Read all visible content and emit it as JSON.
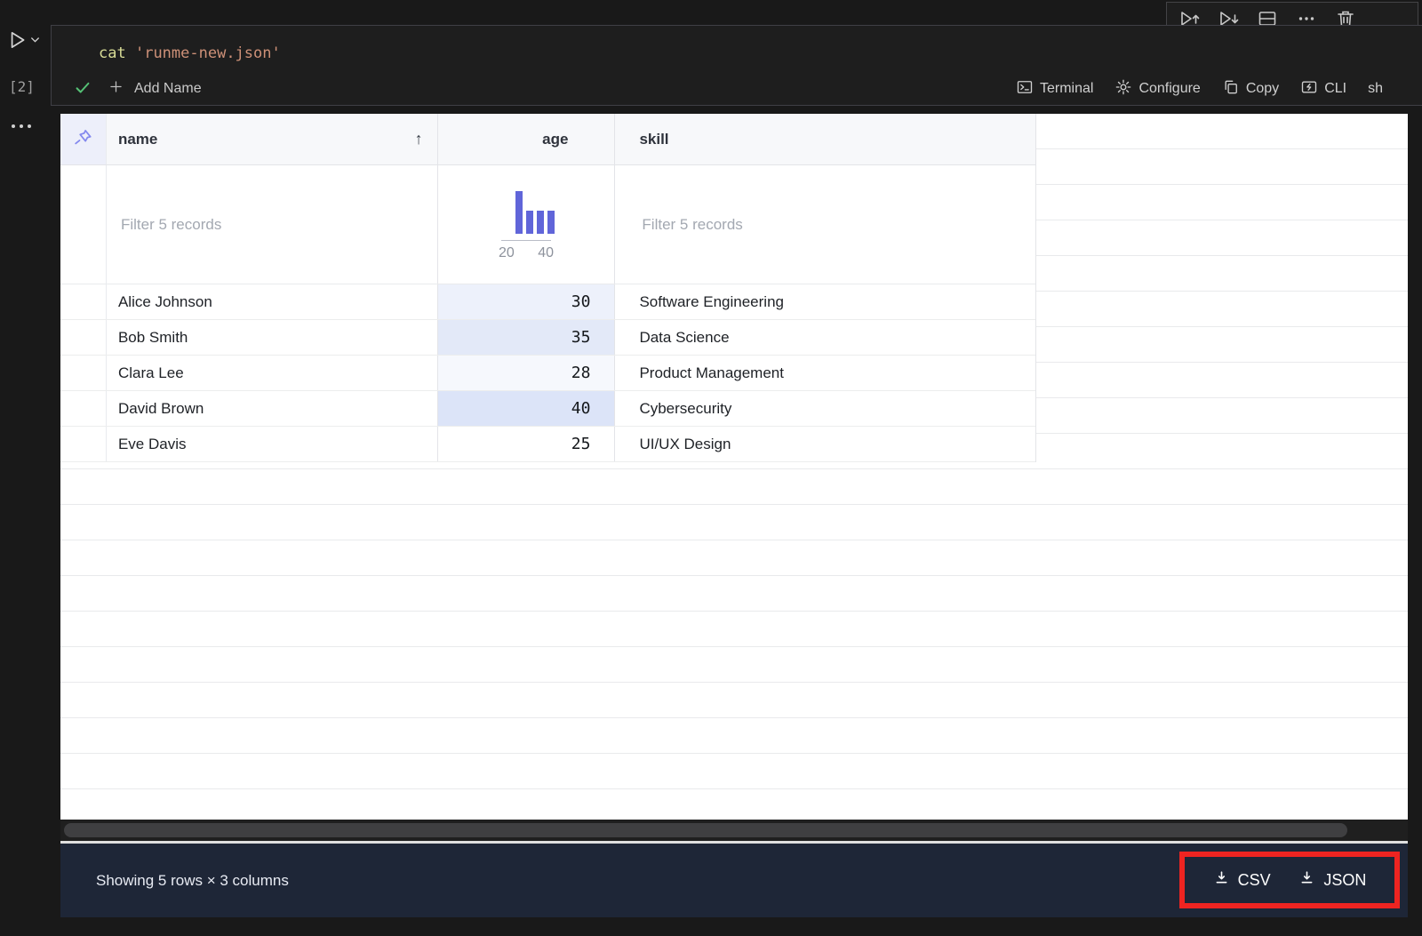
{
  "cell": {
    "execution_count": "[2]",
    "command": "cat",
    "argument": "'runme-new.json'",
    "status": "success",
    "add_name_label": "Add Name",
    "actions": {
      "terminal": "Terminal",
      "configure": "Configure",
      "copy": "Copy",
      "cli": "CLI"
    },
    "language": "sh"
  },
  "grid": {
    "columns": {
      "name": {
        "label": "name",
        "sort": "asc"
      },
      "age": {
        "label": "age"
      },
      "skill": {
        "label": "skill"
      }
    },
    "filters": {
      "name_placeholder": "Filter 5 records",
      "skill_placeholder": "Filter 5 records"
    },
    "age_histogram": {
      "type": "bar",
      "tick_labels": [
        "20",
        "40"
      ],
      "bin_counts": [
        2,
        1,
        1,
        1
      ],
      "bar_color": "#6065d9"
    },
    "rows": [
      {
        "name": "Alice Johnson",
        "age": "30",
        "skill": "Software Engineering",
        "age_heat": "#edf1fb"
      },
      {
        "name": "Bob Smith",
        "age": "35",
        "skill": "Data Science",
        "age_heat": "#e3e9f8"
      },
      {
        "name": "Clara Lee",
        "age": "28",
        "skill": "Product Management",
        "age_heat": "#f6f8fd"
      },
      {
        "name": "David Brown",
        "age": "40",
        "skill": "Cybersecurity",
        "age_heat": "#dce4f8"
      },
      {
        "name": "Eve Davis",
        "age": "25",
        "skill": "UI/UX Design",
        "age_heat": "#ffffff"
      }
    ]
  },
  "footer": {
    "summary": "Showing 5 rows × 3 columns",
    "export_csv_label": "CSV",
    "export_json_label": "JSON",
    "highlight_color": "#ee2421"
  }
}
